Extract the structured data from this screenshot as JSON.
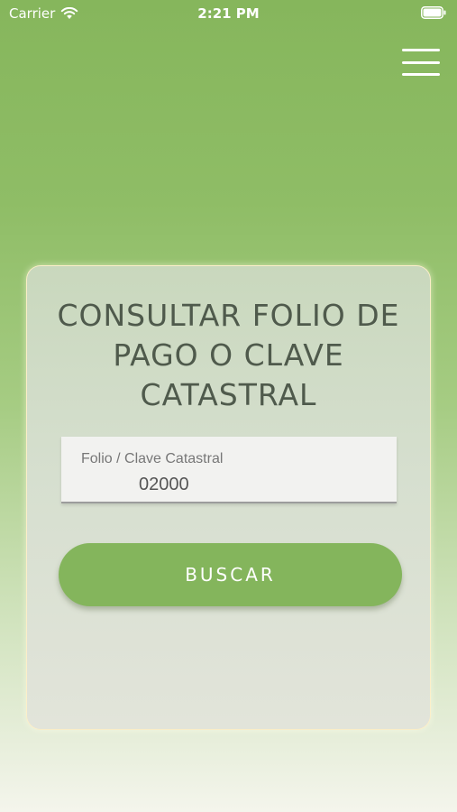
{
  "status_bar": {
    "carrier": "Carrier",
    "time": "2:21 PM",
    "icons": [
      "wifi-icon",
      "battery-icon"
    ]
  },
  "header": {
    "menu_icon": "hamburger-menu-icon"
  },
  "card": {
    "title": "CONSULTAR FOLIO DE PAGO O CLAVE CATASTRAL",
    "field": {
      "label": "Folio / Clave Catastral",
      "value": "02000"
    },
    "search_button": "BUSCAR"
  },
  "colors": {
    "accent": "#84b55c",
    "title_text": "#4f5a4c"
  }
}
